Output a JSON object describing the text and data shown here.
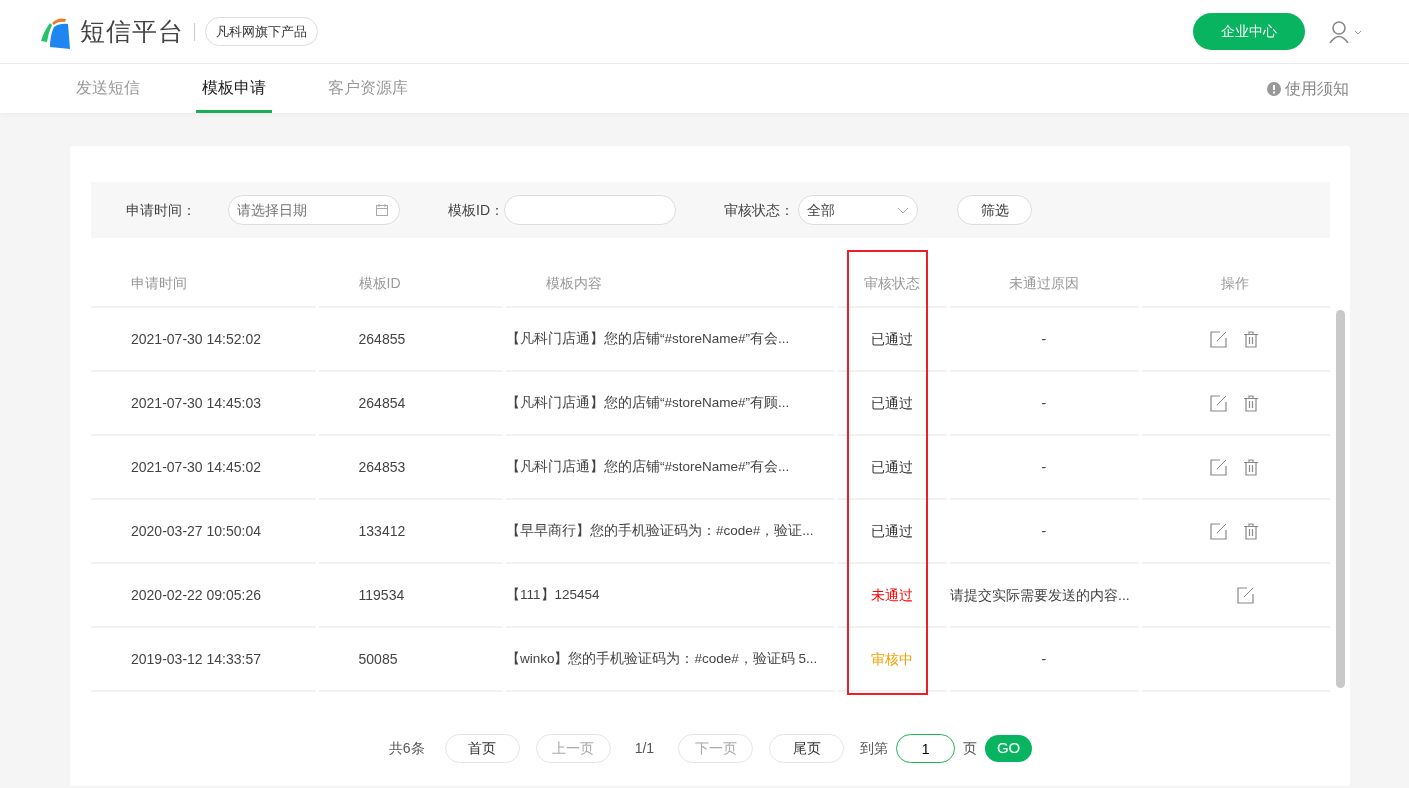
{
  "header": {
    "logo_text": "短信平台",
    "tagline": "凡科网旗下产品",
    "enterprise_button": "企业中心"
  },
  "nav": {
    "tabs": [
      {
        "label": "发送短信",
        "selected": false
      },
      {
        "label": "模板申请",
        "selected": true
      },
      {
        "label": "客户资源库",
        "selected": false
      }
    ],
    "notice_link": "使用须知"
  },
  "filter": {
    "date_label": "申请时间：",
    "date_placeholder": "请选择日期",
    "id_label": "模板ID：",
    "status_label": "审核状态：",
    "status_value": "全部",
    "filter_button": "筛选"
  },
  "table": {
    "status_column_highlighted": true,
    "columns": [
      "申请时间",
      "模板ID",
      "模板内容",
      "审核状态",
      "未通过原因",
      "操作"
    ],
    "rows": [
      {
        "time": "2021-07-30 14:52:02",
        "id": "264855",
        "content": "【凡科门店通】您的店铺“#storeName#”有会...",
        "status": {
          "text": "已通过",
          "color": "#333333"
        },
        "reason": "-",
        "editable": true,
        "deletable": true
      },
      {
        "time": "2021-07-30 14:45:03",
        "id": "264854",
        "content": "【凡科门店通】您的店铺“#storeName#”有顾...",
        "status": {
          "text": "已通过",
          "color": "#333333"
        },
        "reason": "-",
        "editable": true,
        "deletable": true
      },
      {
        "time": "2021-07-30 14:45:02",
        "id": "264853",
        "content": "【凡科门店通】您的店铺“#storeName#”有会...",
        "status": {
          "text": "已通过",
          "color": "#333333"
        },
        "reason": "-",
        "editable": true,
        "deletable": true
      },
      {
        "time": "2020-03-27 10:50:04",
        "id": "133412",
        "content": "【早早商行】您的手机验证码为：#code#，验证...",
        "status": {
          "text": "已通过",
          "color": "#333333"
        },
        "reason": "-",
        "editable": true,
        "deletable": true
      },
      {
        "time": "2020-02-22 09:05:26",
        "id": "119534",
        "content": "【111】125454",
        "status": {
          "text": "未通过",
          "color": "#ff0000"
        },
        "reason": "请提交实际需要发送的内容...",
        "editable": true,
        "deletable": false
      },
      {
        "time": "2019-03-12 14:33:57",
        "id": "50085",
        "content": "【winko】您的手机验证码为：#code#，验证码 5...",
        "status": {
          "text": "审核中",
          "color": "#f5a000"
        },
        "reason": "-",
        "editable": false,
        "deletable": false
      }
    ]
  },
  "pagination": {
    "total": "共6条",
    "first": {
      "label": "首页",
      "disabled": false
    },
    "prev": {
      "label": "上一页",
      "disabled": true
    },
    "page_info": "1/1",
    "next": {
      "label": "下一页",
      "disabled": true
    },
    "last": {
      "label": "尾页",
      "disabled": false
    },
    "goto_label": "到第",
    "page_value": "1",
    "page_suffix": "页",
    "go_button": "GO"
  }
}
